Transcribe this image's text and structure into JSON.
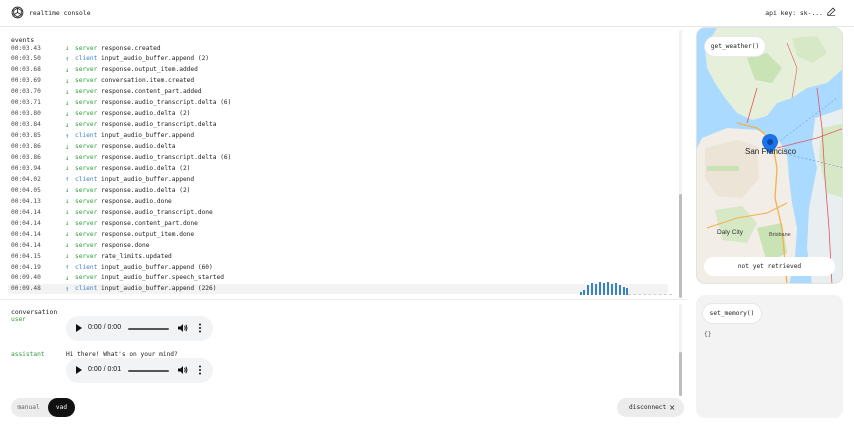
{
  "header": {
    "title": "realtime console",
    "api_key_label": "api key: sk-..."
  },
  "events": {
    "title": "events",
    "rows": [
      {
        "time": "00:03.43",
        "source": "server",
        "arrow": "↓",
        "type": "response.created"
      },
      {
        "time": "00:03.50",
        "source": "client",
        "arrow": "↑",
        "type": "input_audio_buffer.append (2)"
      },
      {
        "time": "00:03.68",
        "source": "server",
        "arrow": "↓",
        "type": "response.output_item.added"
      },
      {
        "time": "00:03.69",
        "source": "server",
        "arrow": "↓",
        "type": "conversation.item.created"
      },
      {
        "time": "00:03.70",
        "source": "server",
        "arrow": "↓",
        "type": "response.content_part.added"
      },
      {
        "time": "00:03.71",
        "source": "server",
        "arrow": "↓",
        "type": "response.audio_transcript.delta (6)"
      },
      {
        "time": "00:03.80",
        "source": "server",
        "arrow": "↓",
        "type": "response.audio.delta (2)"
      },
      {
        "time": "00:03.84",
        "source": "server",
        "arrow": "↓",
        "type": "response.audio_transcript.delta"
      },
      {
        "time": "00:03.85",
        "source": "client",
        "arrow": "↑",
        "type": "input_audio_buffer.append"
      },
      {
        "time": "00:03.86",
        "source": "server",
        "arrow": "↓",
        "type": "response.audio.delta"
      },
      {
        "time": "00:03.86",
        "source": "server",
        "arrow": "↓",
        "type": "response.audio_transcript.delta (6)"
      },
      {
        "time": "00:03.94",
        "source": "server",
        "arrow": "↓",
        "type": "response.audio.delta (2)"
      },
      {
        "time": "00:04.02",
        "source": "client",
        "arrow": "↑",
        "type": "input_audio_buffer.append"
      },
      {
        "time": "00:04.05",
        "source": "server",
        "arrow": "↓",
        "type": "response.audio.delta (2)"
      },
      {
        "time": "00:04.13",
        "source": "server",
        "arrow": "↓",
        "type": "response.audio.done"
      },
      {
        "time": "00:04.14",
        "source": "server",
        "arrow": "↓",
        "type": "response.audio_transcript.done"
      },
      {
        "time": "00:04.14",
        "source": "server",
        "arrow": "↓",
        "type": "response.content_part.done"
      },
      {
        "time": "00:04.14",
        "source": "server",
        "arrow": "↓",
        "type": "response.output_item.done"
      },
      {
        "time": "00:04.14",
        "source": "server",
        "arrow": "↓",
        "type": "response.done"
      },
      {
        "time": "00:04.15",
        "source": "server",
        "arrow": "↓",
        "type": "rate_limits.updated"
      },
      {
        "time": "00:04.19",
        "source": "client",
        "arrow": "↑",
        "type": "input_audio_buffer.append (60)"
      },
      {
        "time": "00:09.40",
        "source": "server",
        "arrow": "↓",
        "type": "input_audio_buffer.speech_started"
      },
      {
        "time": "00:09.48",
        "source": "client",
        "arrow": "↑",
        "type": "input_audio_buffer.append (226)"
      }
    ]
  },
  "conversation": {
    "title": "conversation",
    "items": [
      {
        "role": "user",
        "text": "",
        "audio_time": "0:00 / 0:00"
      },
      {
        "role": "assistant",
        "text": "Hi there! What's on your mind?",
        "audio_time": "0:00 / 0:01"
      }
    ]
  },
  "controls": {
    "mode_manual": "manual",
    "mode_vad": "vad",
    "active_mode": "vad",
    "disconnect_label": "disconnect",
    "disconnect_icon": "×"
  },
  "weather_panel": {
    "function_name": "get_weather()",
    "status": "not yet retrieved",
    "map_labels": {
      "city": "San Francisco",
      "daly_city": "Daly City",
      "brisbane": "Brisbane"
    }
  },
  "memory_panel": {
    "function_name": "set_memory()",
    "value": "{}"
  },
  "colors": {
    "server": "#2e9e3a",
    "client": "#3b82c4",
    "visualizer": "#3b82c4"
  }
}
